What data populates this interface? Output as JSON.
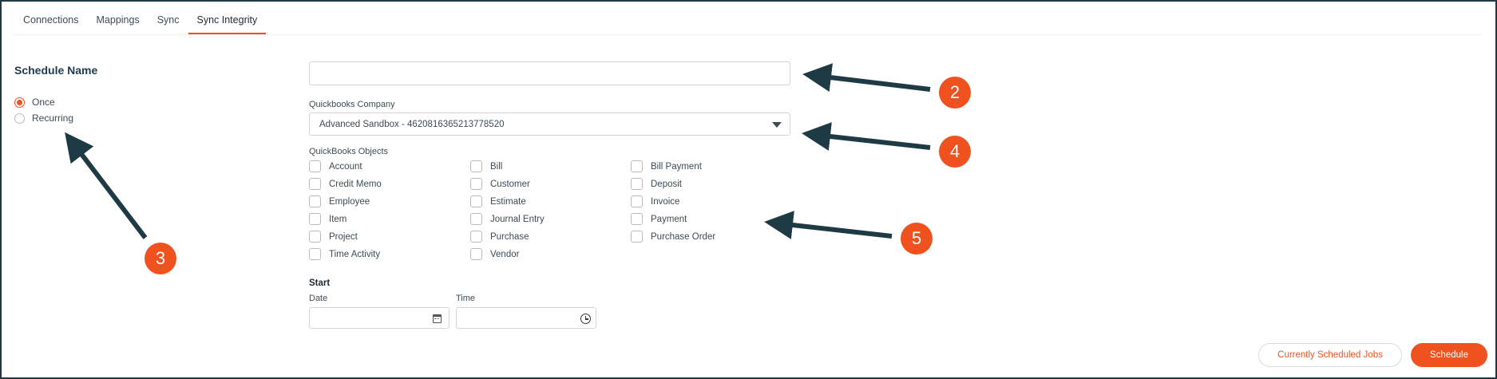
{
  "tabs": [
    {
      "label": "Connections"
    },
    {
      "label": "Mappings"
    },
    {
      "label": "Sync"
    },
    {
      "label": "Sync Integrity",
      "active": true
    }
  ],
  "schedule": {
    "title": "Schedule Name",
    "options": [
      {
        "label": "Once",
        "checked": true
      },
      {
        "label": "Recurring",
        "checked": false
      }
    ],
    "name_value": ""
  },
  "company": {
    "label": "Quickbooks Company",
    "selected": "Advanced Sandbox - 4620816365213778520"
  },
  "objects": {
    "label": "QuickBooks Objects",
    "items": [
      "Account",
      "Bill",
      "Bill Payment",
      "Credit Memo",
      "Customer",
      "Deposit",
      "Employee",
      "Estimate",
      "Invoice",
      "Item",
      "Journal Entry",
      "Payment",
      "Project",
      "Purchase",
      "Purchase Order",
      "Time Activity",
      "Vendor"
    ]
  },
  "start": {
    "label": "Start",
    "date_label": "Date",
    "time_label": "Time"
  },
  "buttons": {
    "scheduled_jobs": "Currently Scheduled Jobs",
    "schedule": "Schedule"
  },
  "annotations": {
    "badge_2": "2",
    "badge_3": "3",
    "badge_4": "4",
    "badge_5": "5"
  },
  "colors": {
    "accent": "#f0521f",
    "arrow": "#1e3a44"
  }
}
